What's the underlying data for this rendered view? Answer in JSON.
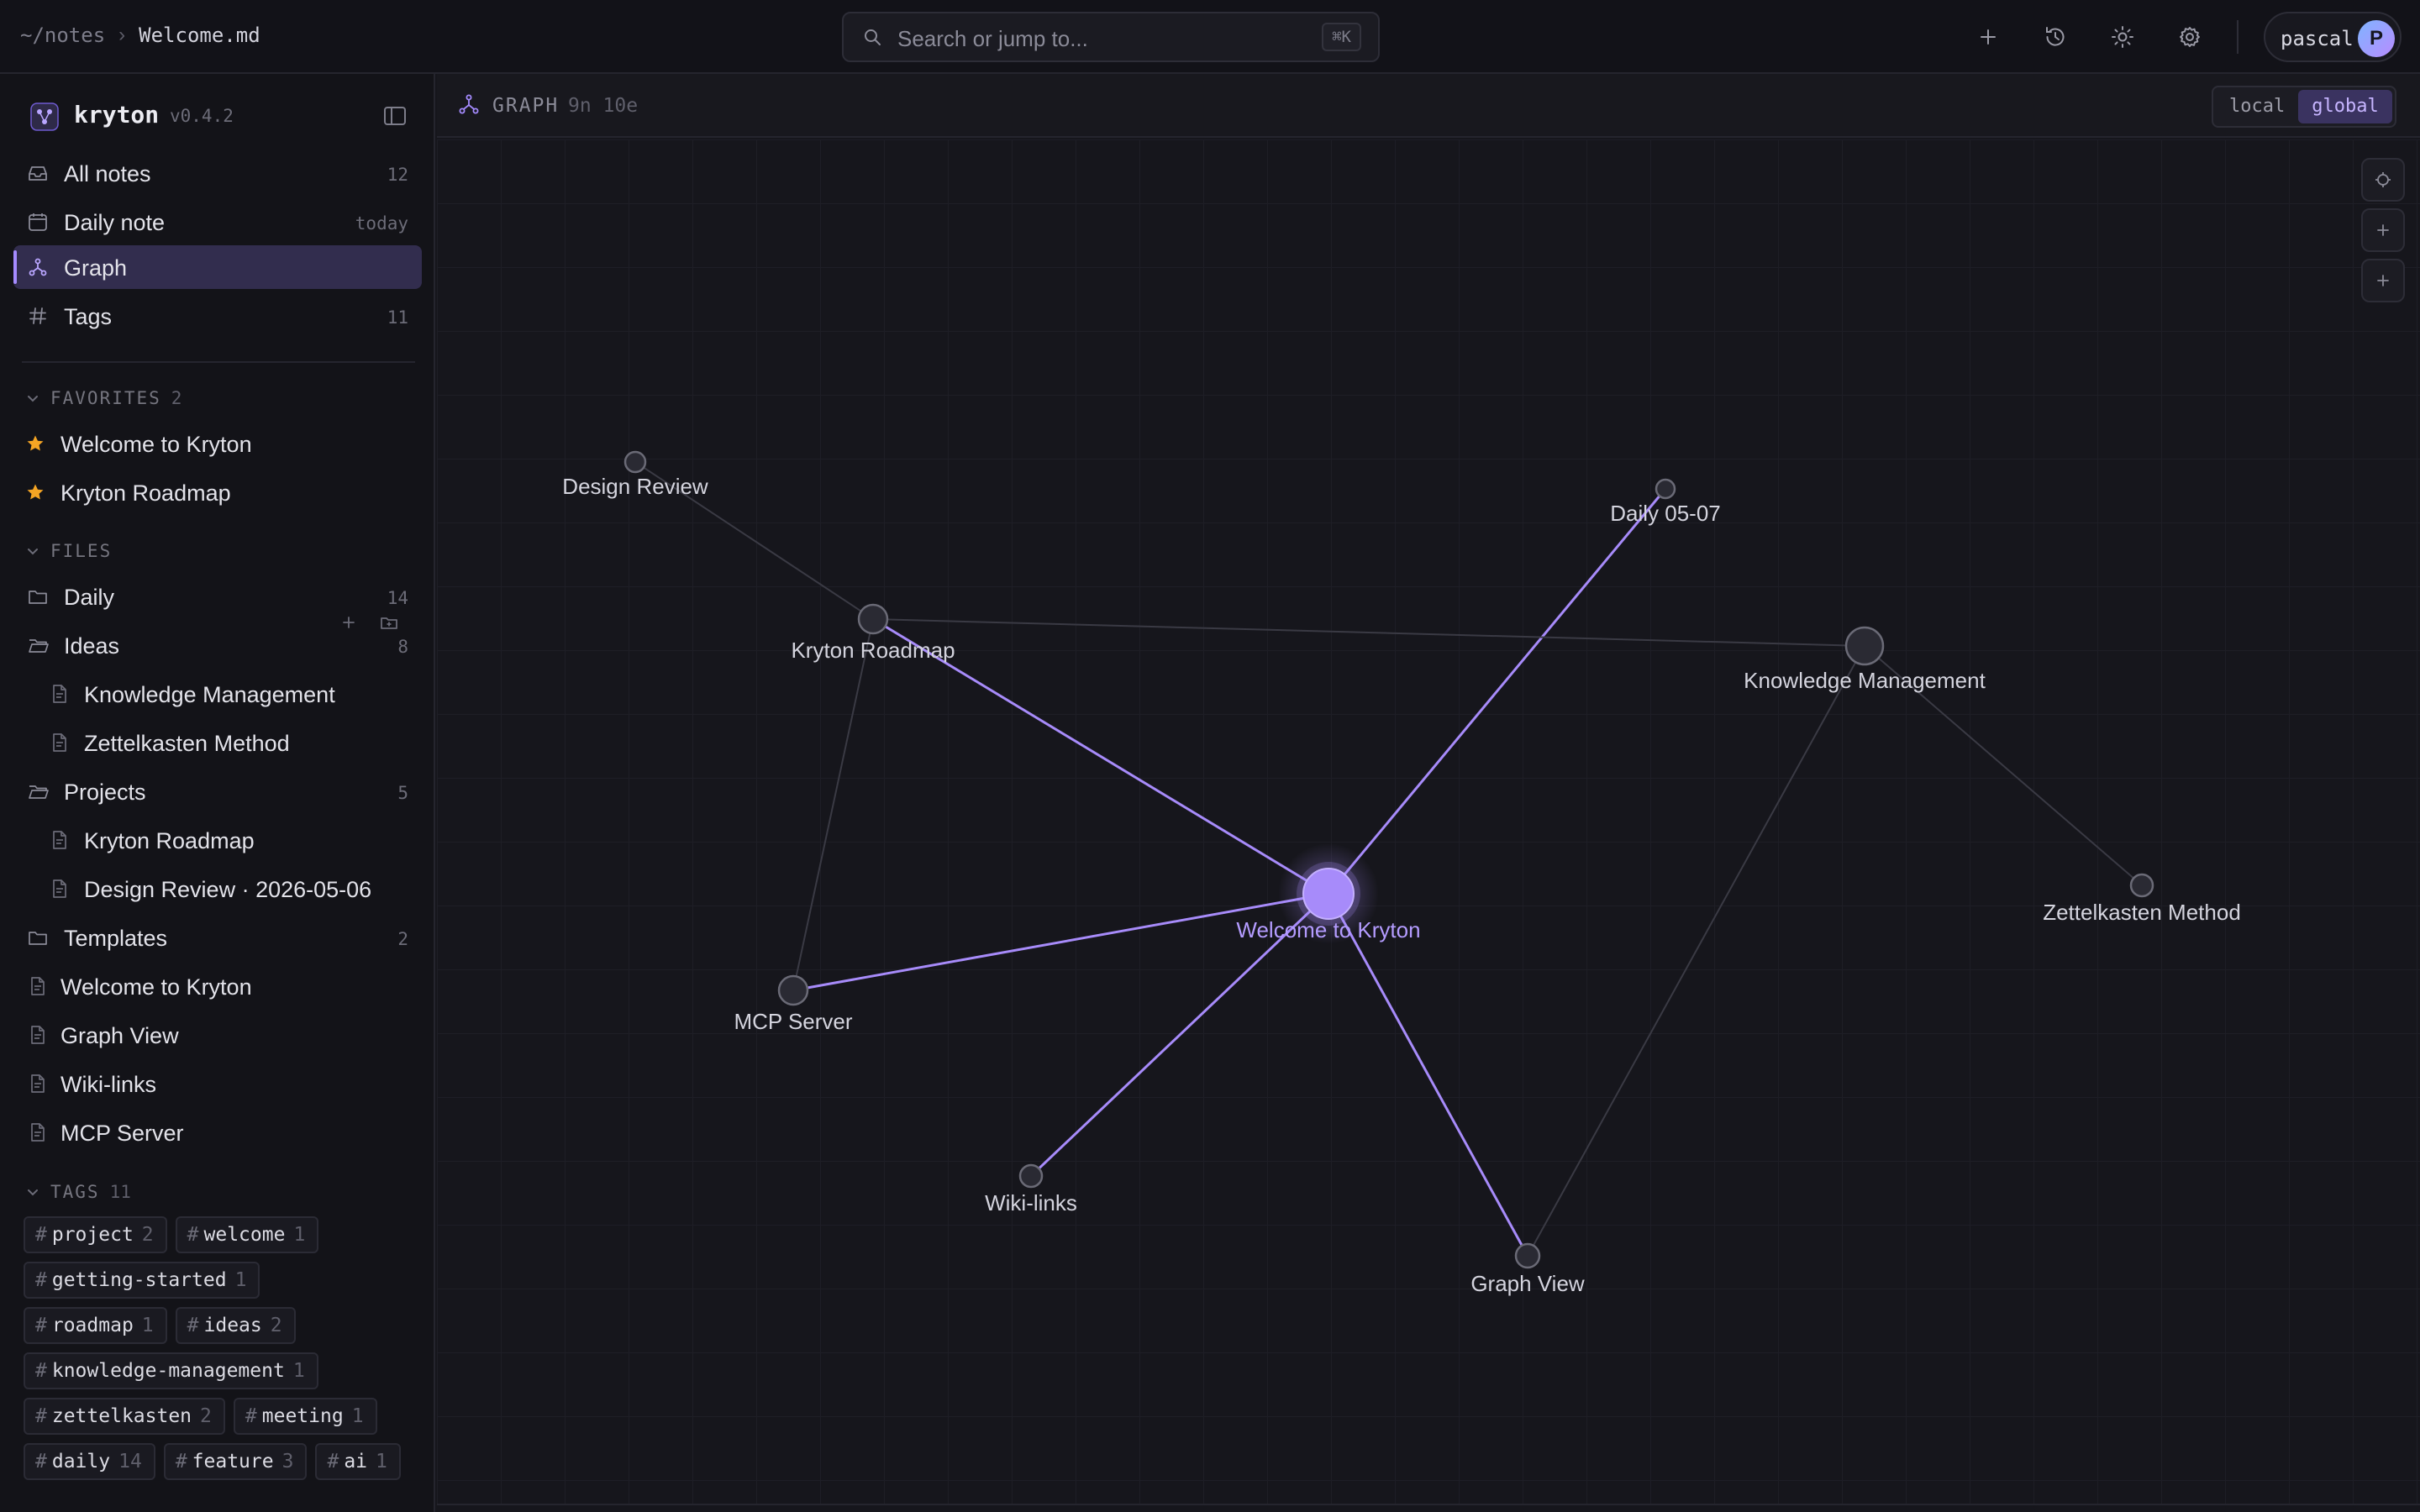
{
  "topbar": {
    "breadcrumb_root": "~/notes",
    "breadcrumb_sep": "›",
    "breadcrumb_current": "Welcome.md",
    "search_placeholder": "Search or jump to...",
    "search_shortcut": "⌘K",
    "user_name": "pascal",
    "user_initial": "P",
    "icons": [
      "plus-icon",
      "history-icon",
      "sun-icon",
      "gear-icon"
    ]
  },
  "sidebar": {
    "brand": "kryton",
    "version": "v0.4.2",
    "nav": [
      {
        "label": "All notes",
        "count": "12",
        "icon": "inbox-icon"
      },
      {
        "label": "Daily note",
        "count": "today",
        "icon": "calendar-icon"
      },
      {
        "label": "Graph",
        "count": "",
        "icon": "graph-icon",
        "active": true
      },
      {
        "label": "Tags",
        "count": "11",
        "icon": "hash-icon"
      }
    ],
    "favorites": {
      "label": "FAVORITES",
      "count": "2",
      "items": [
        "Welcome to Kryton",
        "Kryton Roadmap"
      ]
    },
    "files": {
      "label": "FILES",
      "items": [
        {
          "label": "Daily",
          "count": "14",
          "type": "folder"
        },
        {
          "label": "Ideas",
          "count": "8",
          "type": "folder-open"
        },
        {
          "label": "Knowledge Management",
          "count": "",
          "type": "file-nested"
        },
        {
          "label": "Zettelkasten Method",
          "count": "",
          "type": "file-nested"
        },
        {
          "label": "Projects",
          "count": "5",
          "type": "folder-open"
        },
        {
          "label": "Kryton Roadmap",
          "count": "",
          "type": "file-nested"
        },
        {
          "label": "Design Review · 2026-05-06",
          "count": "",
          "type": "file-nested"
        },
        {
          "label": "Templates",
          "count": "2",
          "type": "folder"
        },
        {
          "label": "Welcome to Kryton",
          "count": "",
          "type": "file"
        },
        {
          "label": "Graph View",
          "count": "",
          "type": "file"
        },
        {
          "label": "Wiki-links",
          "count": "",
          "type": "file"
        },
        {
          "label": "MCP Server",
          "count": "",
          "type": "file"
        }
      ]
    },
    "tags": {
      "label": "TAGS",
      "count": "11",
      "rows": [
        [
          {
            "name": "project",
            "count": "2"
          },
          {
            "name": "welcome",
            "count": "1"
          }
        ],
        [
          {
            "name": "getting-started",
            "count": "1"
          }
        ],
        [
          {
            "name": "roadmap",
            "count": "1"
          },
          {
            "name": "ideas",
            "count": "2"
          }
        ],
        [
          {
            "name": "knowledge-management",
            "count": "1"
          }
        ],
        [
          {
            "name": "zettelkasten",
            "count": "2"
          },
          {
            "name": "meeting",
            "count": "1"
          }
        ],
        [
          {
            "name": "daily",
            "count": "14"
          },
          {
            "name": "feature",
            "count": "3"
          },
          {
            "name": "ai",
            "count": "1"
          }
        ]
      ]
    }
  },
  "graph": {
    "title": "GRAPH",
    "stats": "9n 10e",
    "scope_local": "local",
    "scope_global": "global",
    "colors": {
      "accent": "#a78bfa",
      "node": "#2a2a33",
      "node_stroke": "#6a6a76",
      "edge": "#3a3a44"
    },
    "nodes": [
      {
        "id": "welcome",
        "label": "Welcome to Kryton",
        "center": true
      },
      {
        "id": "roadmap",
        "label": "Kryton Roadmap"
      },
      {
        "id": "design",
        "label": "Design Review"
      },
      {
        "id": "daily",
        "label": "Daily 05-07"
      },
      {
        "id": "km",
        "label": "Knowledge Management"
      },
      {
        "id": "zettel",
        "label": "Zettelkasten Method"
      },
      {
        "id": "mcp",
        "label": "MCP Server"
      },
      {
        "id": "wiki",
        "label": "Wiki-links"
      },
      {
        "id": "graphview",
        "label": "Graph View"
      }
    ],
    "edges": [
      [
        "welcome",
        "roadmap"
      ],
      [
        "welcome",
        "daily"
      ],
      [
        "welcome",
        "mcp"
      ],
      [
        "welcome",
        "wiki"
      ],
      [
        "welcome",
        "graphview"
      ],
      [
        "design",
        "roadmap"
      ],
      [
        "roadmap",
        "km"
      ],
      [
        "roadmap",
        "mcp"
      ],
      [
        "km",
        "zettel"
      ],
      [
        "km",
        "graphview"
      ]
    ]
  }
}
